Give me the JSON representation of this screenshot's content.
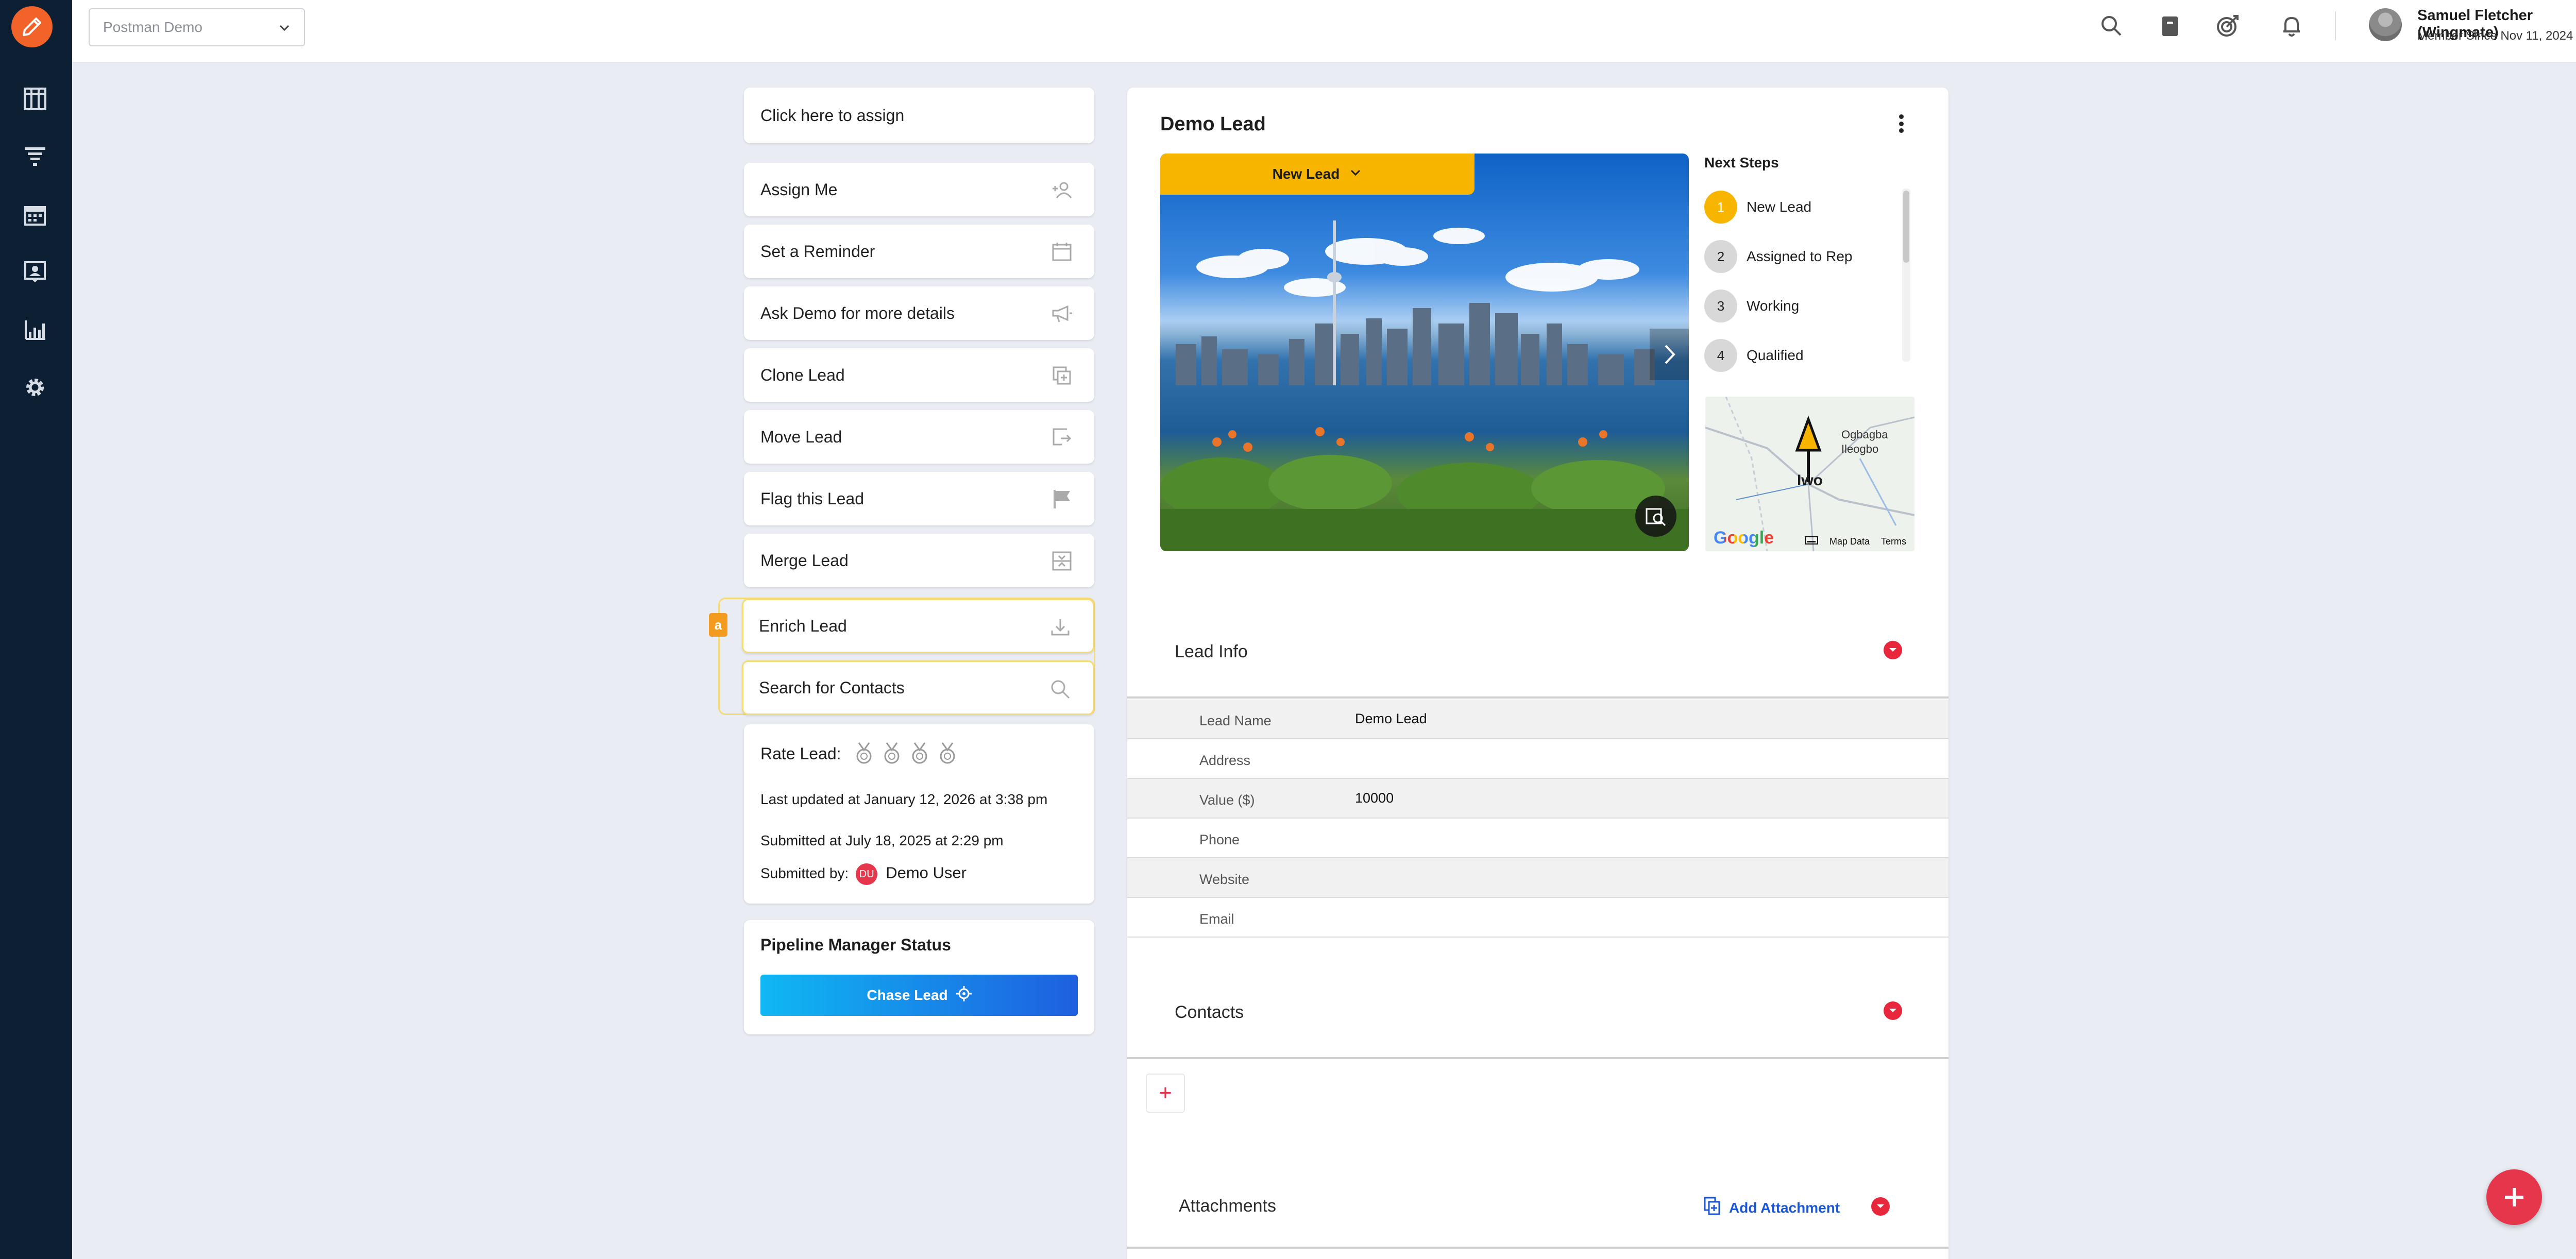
{
  "topbar": {
    "org_select": "Postman Demo",
    "user_name": "Samuel Fletcher (Wingmate)",
    "member_since": "Member Since Nov 11, 2024"
  },
  "rail": {
    "icons": [
      "pipeline-board-icon",
      "funnel-icon",
      "calendar-icon",
      "contacts-icon",
      "analytics-icon",
      "settings-gear-icon"
    ]
  },
  "assign": {
    "label": "Click here to assign"
  },
  "actions": [
    {
      "label": "Assign Me",
      "icon": "add-user-icon"
    },
    {
      "label": "Set a Reminder",
      "icon": "calendar-icon"
    },
    {
      "label": "Ask Demo for more details",
      "icon": "megaphone-icon"
    },
    {
      "label": "Clone Lead",
      "icon": "copy-icon"
    },
    {
      "label": "Move Lead",
      "icon": "move-icon"
    },
    {
      "label": "Flag this Lead",
      "icon": "flag-icon"
    },
    {
      "label": "Merge Lead",
      "icon": "merge-icon"
    },
    {
      "label": "Enrich Lead",
      "icon": "download-icon"
    },
    {
      "label": "Search for Contacts",
      "icon": "search-icon"
    }
  ],
  "enrich_badge": "a",
  "info": {
    "rate_label": "Rate Lead:",
    "rating": 0,
    "rating_max": 4,
    "last_updated": "Last updated at January 12, 2026 at 3:38 pm",
    "submitted_at": "Submitted at July 18, 2025 at 2:29 pm",
    "submitted_by_label": "Submitted by:",
    "submitter_initials": "DU",
    "submitter_name": "Demo User"
  },
  "pipeline": {
    "title": "Pipeline Manager Status",
    "chase_label": "Chase Lead"
  },
  "lead": {
    "title": "Demo Lead",
    "status": "New Lead",
    "next_steps_title": "Next Steps",
    "steps": [
      {
        "num": "1",
        "label": "New Lead",
        "active": true
      },
      {
        "num": "2",
        "label": "Assigned to Rep",
        "active": false
      },
      {
        "num": "3",
        "label": "Working",
        "active": false
      },
      {
        "num": "4",
        "label": "Qualified",
        "active": false
      }
    ],
    "map": {
      "place": "Iwo",
      "nearby_1": "Ogbagba",
      "nearby_2": "Ileogbo",
      "brand": "Google",
      "map_data": "Map Data",
      "terms": "Terms"
    }
  },
  "lead_info": {
    "title": "Lead Info",
    "rows": [
      {
        "key": "Lead Name",
        "value": "Demo Lead"
      },
      {
        "key": "Address",
        "value": ""
      },
      {
        "key": "Value ($)",
        "value": "10000"
      },
      {
        "key": "Phone",
        "value": ""
      },
      {
        "key": "Website",
        "value": ""
      },
      {
        "key": "Email",
        "value": ""
      }
    ]
  },
  "contacts": {
    "title": "Contacts",
    "add_symbol": "+"
  },
  "attachments": {
    "title": "Attachments",
    "add_label": "Add Attachment"
  },
  "colors": {
    "accent": "#f7b500",
    "brand": "#f2632a",
    "danger": "#e5364b",
    "rail": "#0d2033",
    "link": "#1a56d6"
  }
}
